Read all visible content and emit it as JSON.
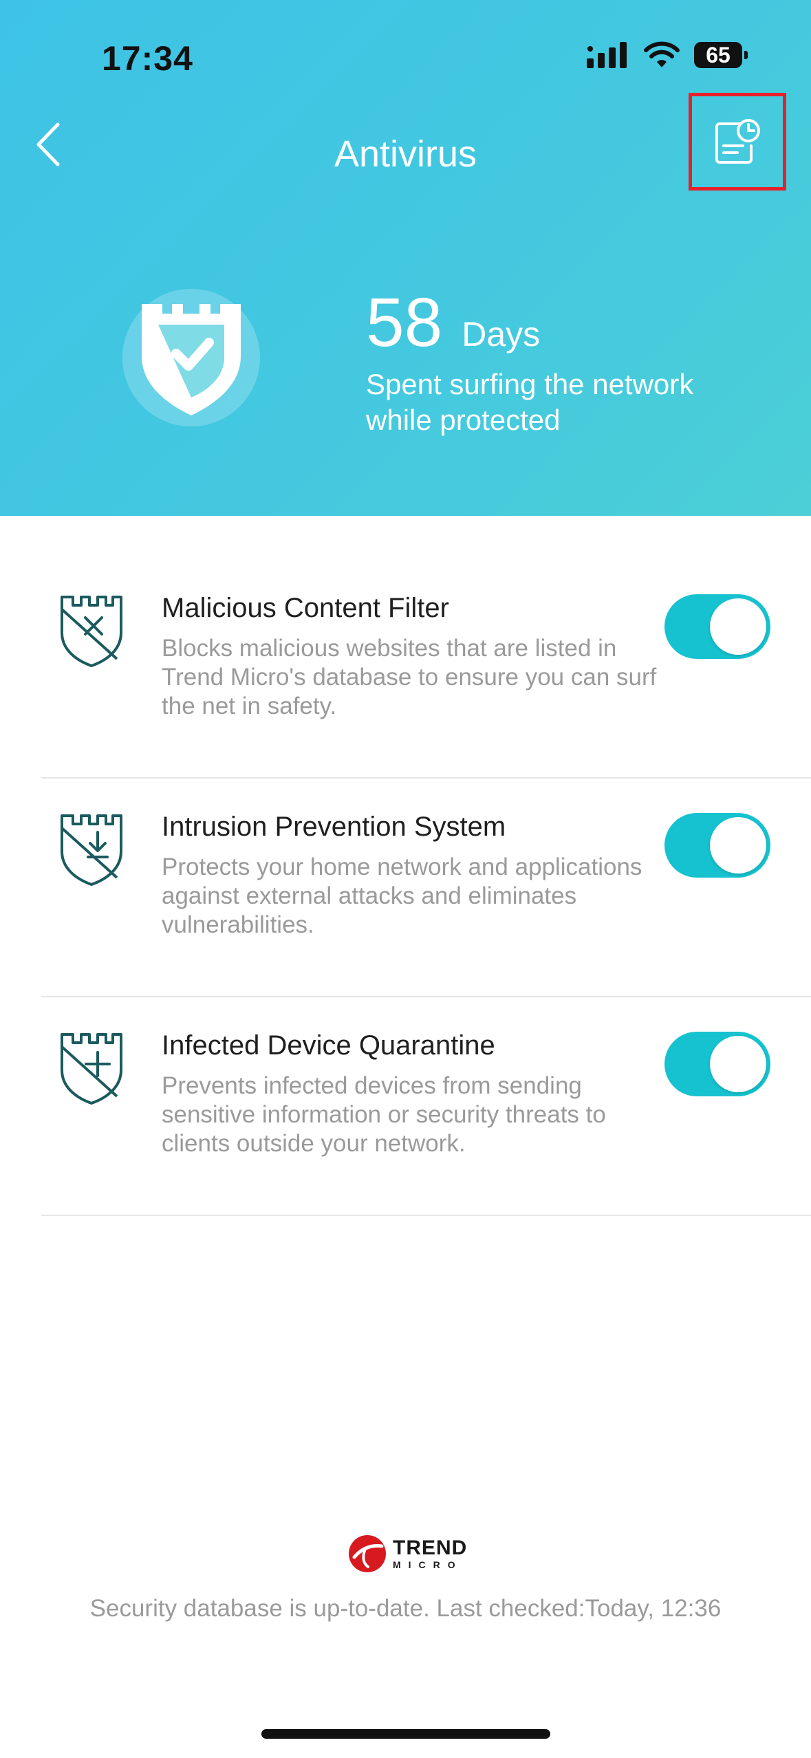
{
  "status_bar": {
    "time": "17:34",
    "battery": "65"
  },
  "nav": {
    "title": "Antivirus"
  },
  "hero": {
    "days_number": "58",
    "days_unit": "Days",
    "description": "Spent surfing the network while protected"
  },
  "features": [
    {
      "title": "Malicious Content Filter",
      "description": "Blocks malicious websites that are listed in Trend Micro's database to ensure you can surf the net in safety.",
      "icon": "shield-x-icon",
      "enabled": true
    },
    {
      "title": "Intrusion Prevention System",
      "description": "Protects your home network and applications against external attacks and eliminates vulnerabilities.",
      "icon": "shield-download-icon",
      "enabled": true
    },
    {
      "title": "Infected Device Quarantine",
      "description": "Prevents infected devices from sending sensitive information or security threats to clients outside your network.",
      "icon": "shield-plus-icon",
      "enabled": true
    }
  ],
  "footer": {
    "brand_line1": "TREND",
    "brand_line2": "MICRO",
    "status": "Security database is up-to-date. Last checked:Today, 12:36"
  },
  "colors": {
    "header_gradient_start": "#3ec3e6",
    "header_gradient_end": "#4ccfd6",
    "toggle_on": "#16c2cf",
    "icon_stroke": "#1b5a5e",
    "highlight_box": "#e8202a",
    "brand_red": "#d71920"
  }
}
